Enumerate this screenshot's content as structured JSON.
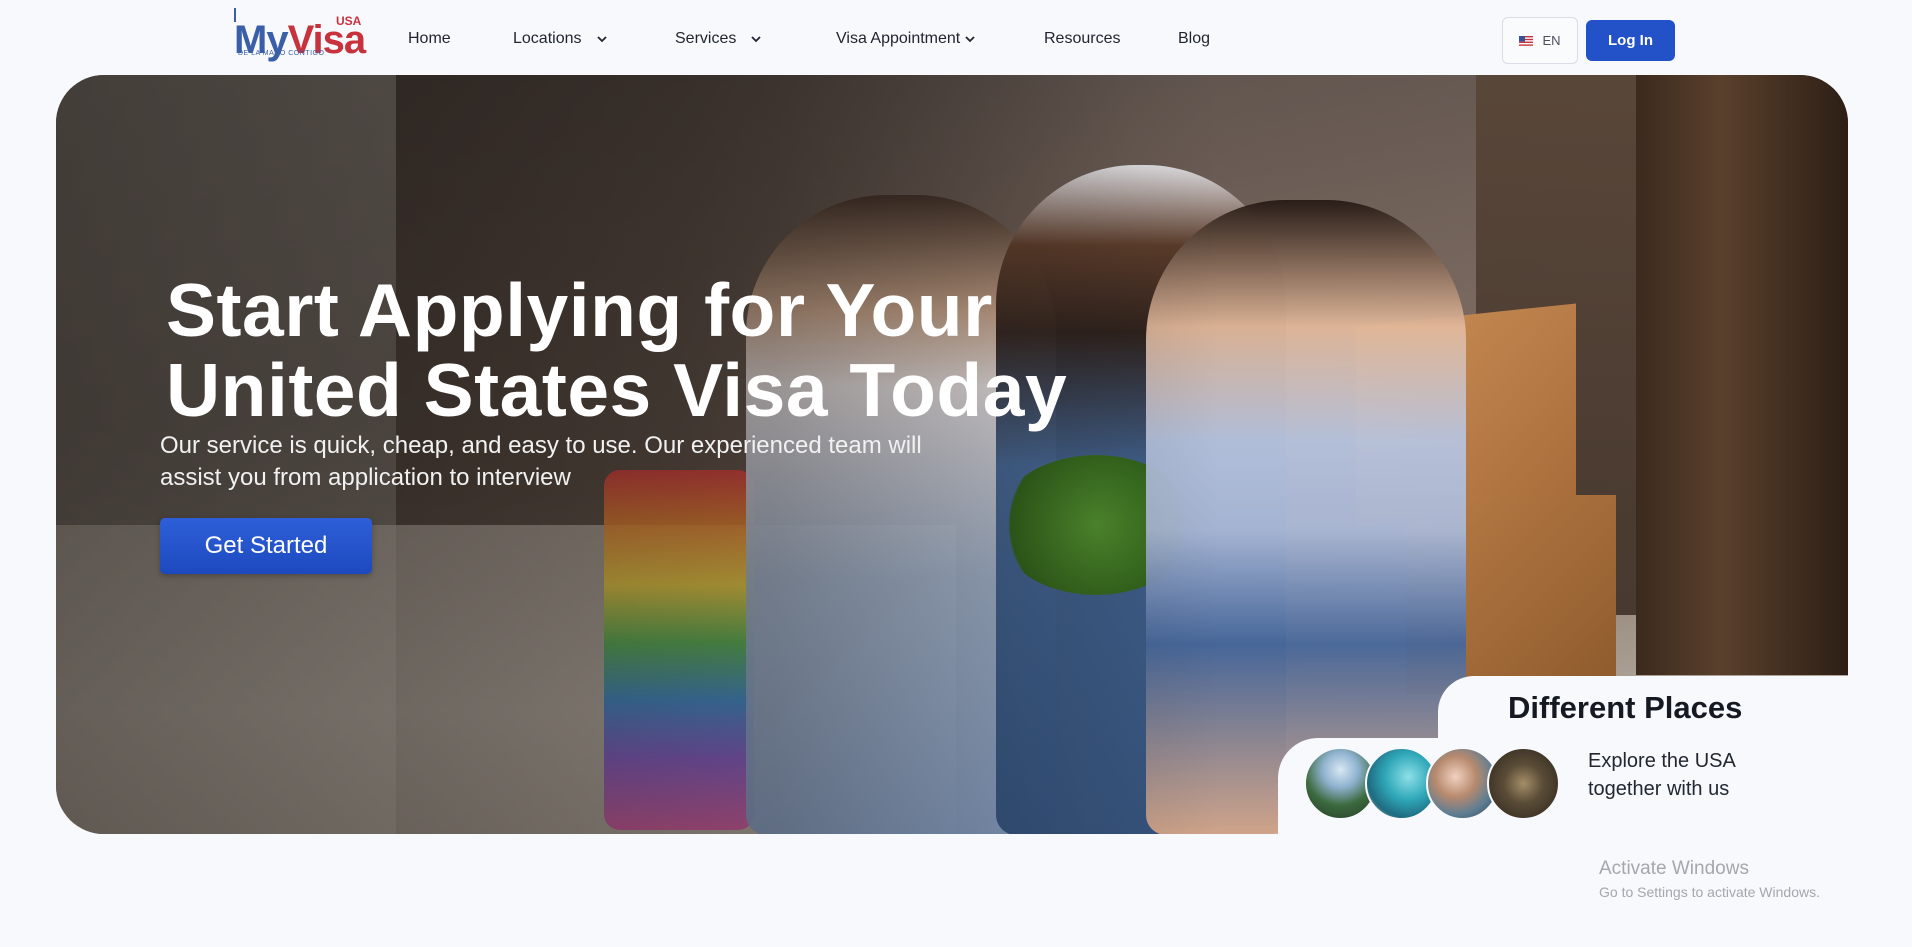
{
  "brand": {
    "name_prefix": "My",
    "name_suffix": "Visa",
    "country": "USA",
    "tagline": "DE LA MANO CONTIGO"
  },
  "nav": {
    "home": "Home",
    "locations": "Locations",
    "services": "Services",
    "visa_appointment": "Visa Appointment",
    "resources": "Resources",
    "blog": "Blog"
  },
  "header": {
    "language": "EN",
    "login_label": "Log In"
  },
  "hero": {
    "title_line1": "Start Applying for Your",
    "title_line2": "United States Visa Today",
    "subtitle": "Our service is quick, cheap, and easy to use. Our experienced team will assist you from application to interview",
    "cta_label": "Get Started"
  },
  "places": {
    "title": "Different Places",
    "subtitle": "Explore the USA together with us"
  },
  "os_watermark": {
    "line1": "Activate Windows",
    "line2": "Go to Settings to activate Windows."
  },
  "colors": {
    "primary": "#2251c8",
    "brand_blue": "#3a5ea8",
    "brand_red": "#c8323c",
    "page_bg": "#f7f9fc"
  },
  "icons": [
    "chevron-down-icon",
    "us-flag-icon"
  ]
}
